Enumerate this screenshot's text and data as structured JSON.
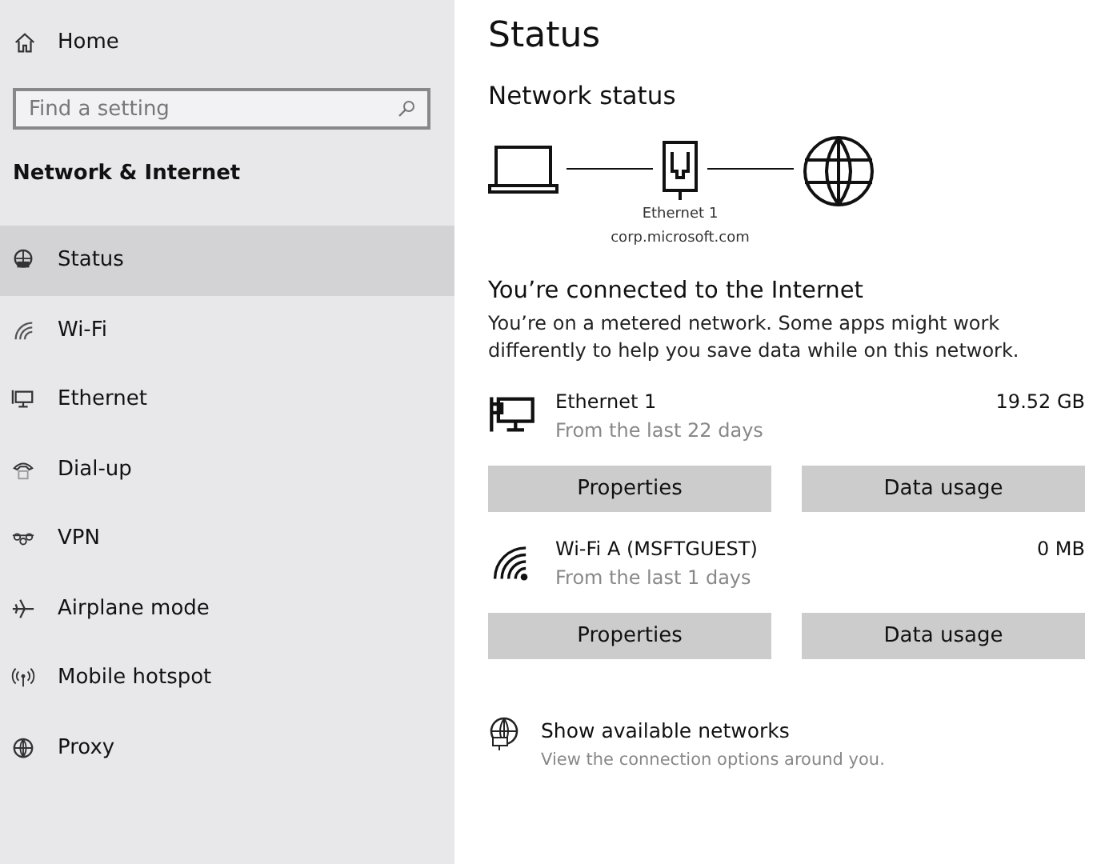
{
  "sidebar": {
    "home": "Home",
    "search": {
      "placeholder": "Find a setting"
    },
    "heading": "Network & Internet",
    "items": [
      {
        "label": "Status",
        "kind": "status",
        "selected": true
      },
      {
        "label": "Wi-Fi",
        "kind": "wifi",
        "selected": false
      },
      {
        "label": "Ethernet",
        "kind": "ethernet",
        "selected": false
      },
      {
        "label": "Dial-up",
        "kind": "dialup",
        "selected": false
      },
      {
        "label": "VPN",
        "kind": "vpn",
        "selected": false
      },
      {
        "label": "Airplane mode",
        "kind": "airplane",
        "selected": false
      },
      {
        "label": "Mobile hotspot",
        "kind": "hotspot",
        "selected": false
      },
      {
        "label": "Proxy",
        "kind": "proxy",
        "selected": false
      }
    ]
  },
  "main": {
    "title": "Status",
    "section": "Network status",
    "diagram": {
      "adapter": "Ethernet 1",
      "domain": "corp.microsoft.com"
    },
    "connected_title": "You’re connected to the Internet",
    "connected_text": "You’re on a metered network. Some apps might work differently to help you save data while on this network.",
    "connections": [
      {
        "kind": "ethernet",
        "name": "Ethernet 1",
        "period": "From the last 22 days",
        "usage": "19.52 GB",
        "buttons": [
          "Properties",
          "Data usage"
        ]
      },
      {
        "kind": "wifi",
        "name": "Wi-Fi A (MSFTGUEST)",
        "period": "From the last 1 days",
        "usage": "0 MB",
        "buttons": [
          "Properties",
          "Data usage"
        ]
      }
    ],
    "show_networks": {
      "title": "Show available networks",
      "subtitle": "View the connection options around you."
    }
  }
}
